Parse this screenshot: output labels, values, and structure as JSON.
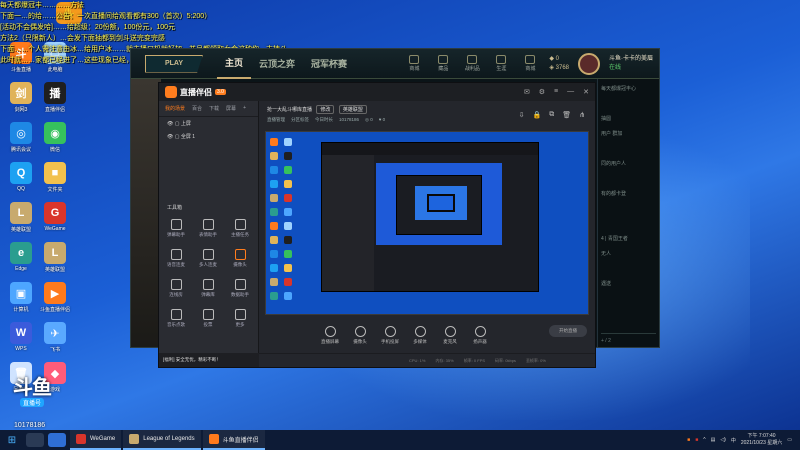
{
  "overlay": {
    "lines": [
      "每天都爆冠丰…………方法",
      "下面一…的给……公告：一次直播间给观看都有300（首次）5:200）",
      "[活动不会偶发哈]……给超级：20份额，100份元，100元",
      "方法2（只限新人）…会发下面抽都到剑斗送完变完感",
      "下面……个人需注意由冰…给用户冰……就主播口机就好加，并且都领取女金这种你…支持斗",
      "此时就……家都已经进了…这些现象已经，刚刚都，谢谢大家积极参与！"
    ]
  },
  "desktop": {
    "icons": [
      {
        "label": "斗鱼直播",
        "color": "#ff7a1c",
        "glyph": "斗"
      },
      {
        "label": "此电脑",
        "color": "#9fd3ff",
        "glyph": "▭"
      },
      {
        "label": "剑网3",
        "color": "#e0b35a",
        "glyph": "剑"
      },
      {
        "label": "直播伴侣",
        "color": "#1f1f1f",
        "glyph": "播"
      },
      {
        "label": "腾讯会议",
        "color": "#1e88e5",
        "glyph": "◎"
      },
      {
        "label": "微信",
        "color": "#36c15d",
        "glyph": "◉"
      },
      {
        "label": "QQ",
        "color": "#1da1f2",
        "glyph": "Q"
      },
      {
        "label": "文件夹",
        "color": "#f2c14e",
        "glyph": "■"
      },
      {
        "label": "英雄联盟",
        "color": "#c8aa6e",
        "glyph": "L"
      },
      {
        "label": "WeGame",
        "color": "#d9352b",
        "glyph": "G"
      },
      {
        "label": "Edge",
        "color": "#2a9d8f",
        "glyph": "e"
      },
      {
        "label": "英雄联盟",
        "color": "#c8aa6e",
        "glyph": "L"
      },
      {
        "label": "计算机",
        "color": "#4da6ff",
        "glyph": "▣"
      },
      {
        "label": "斗鱼直播伴侣",
        "color": "#ff7a1c",
        "glyph": "▶"
      },
      {
        "label": "WPS",
        "color": "#3b5bdb",
        "glyph": "W"
      },
      {
        "label": "飞书",
        "color": "#5aa9ff",
        "glyph": "✈"
      },
      {
        "label": "回收站",
        "color": "#cfe3ff",
        "glyph": "🗑"
      },
      {
        "label": "游戏",
        "color": "#ff5c7a",
        "glyph": "◆"
      }
    ]
  },
  "lol": {
    "play": "PLAY",
    "tabs": [
      "主页",
      "云顶之弈",
      "冠军杯赛"
    ],
    "icons": [
      "商城",
      "藏品",
      "战利品",
      "生涯",
      "商城"
    ],
    "currency": {
      "be": "3768",
      "rp": "0"
    },
    "name": "斗鱼·卡卡的美眉",
    "status": "在线",
    "side_items": [
      "每天都爆冠丰心",
      "",
      "抽圆",
      "用户 群加",
      "",
      "同的用户人",
      "",
      "有的都卡登",
      "",
      "",
      "4 | 青国王者",
      "无人",
      "",
      "遇送"
    ],
    "side_footer": "+ / 2"
  },
  "dy": {
    "title": "直播伴侣",
    "version": "3.0",
    "left_tabs": [
      "我的场景",
      "百合",
      "下载",
      "屏幕"
    ],
    "scenes": [
      "上屏",
      "全屏 1"
    ],
    "tools_header": "工具箱",
    "tools": [
      "弹幕助手",
      "表情助手",
      "主播任务",
      "语音连麦",
      "多人连麦",
      "摄像头",
      "连线房",
      "弹幕库",
      "数据助手",
      "音乐点歌",
      "投票",
      "更多"
    ],
    "ad_text": "[福利] 安全无忧，精彩不断！",
    "room": {
      "name": "抢一大乱斗哪库直播",
      "edit": "修改",
      "cat": "英雄联盟"
    },
    "room_meta": [
      "直播管理",
      "分区标签",
      "今日时长",
      "10178186",
      "◎ 0",
      "♥ 0"
    ],
    "bottom": [
      "直播屏幕",
      "摄像头",
      "手机投屏",
      "多媒体",
      "麦克风",
      "扬声器"
    ],
    "start": "开始直播",
    "status": [
      "CPU: 1%",
      "内存: 35%",
      "帧率: 0 FPS",
      "码率: 0kbps",
      "丢帧率: 0%"
    ]
  },
  "watermark": {
    "big": "斗鱼",
    "tag": "直播号",
    "room": "10178186"
  },
  "taskbar": {
    "apps": [
      "WeGame",
      "League of Legends",
      "斗鱼直播伴侣"
    ],
    "time": "下午 7:07:40",
    "date": "2021/10/23 星期六"
  }
}
